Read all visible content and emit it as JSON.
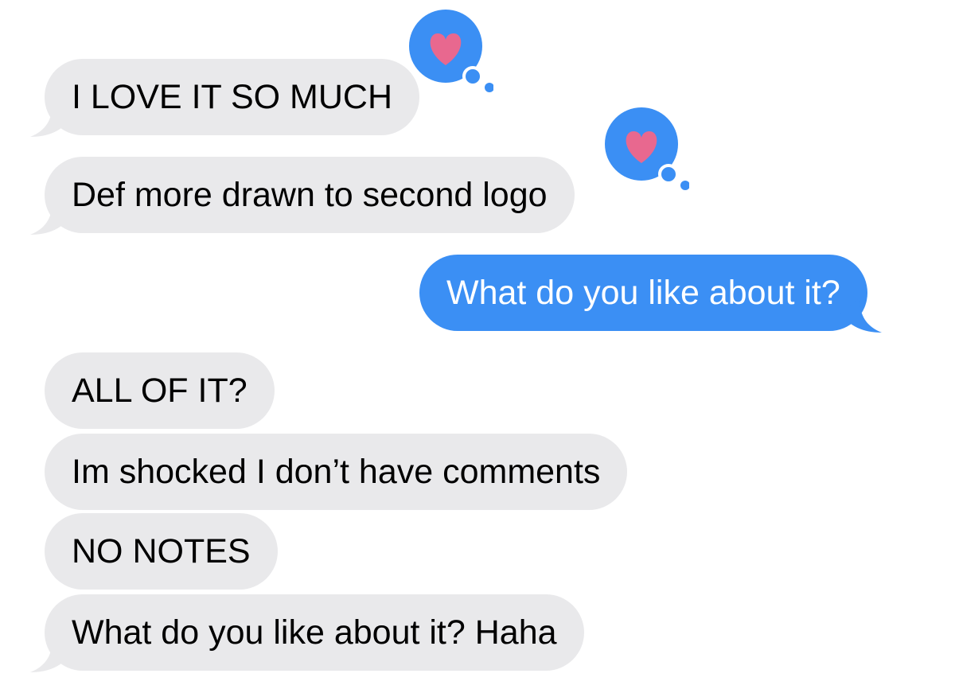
{
  "conversation": {
    "messages": [
      {
        "sender": "other",
        "text": "I LOVE IT SO MUCH",
        "reaction": "heart-icon"
      },
      {
        "sender": "other",
        "text": "Def more drawn to second logo",
        "reaction": "heart-icon"
      },
      {
        "sender": "me",
        "text": "What do you like about it?"
      },
      {
        "sender": "other",
        "text": "ALL OF IT?"
      },
      {
        "sender": "other",
        "text": "Im shocked I don’t have comments"
      },
      {
        "sender": "other",
        "text": "NO NOTES"
      },
      {
        "sender": "other",
        "text": "What do you like about it? Haha"
      }
    ]
  },
  "colors": {
    "received_bubble": "#e9e9eb",
    "sent_bubble": "#3b8ff4",
    "tapback_bubble": "#3b8ff4",
    "heart": "#e8688f"
  }
}
